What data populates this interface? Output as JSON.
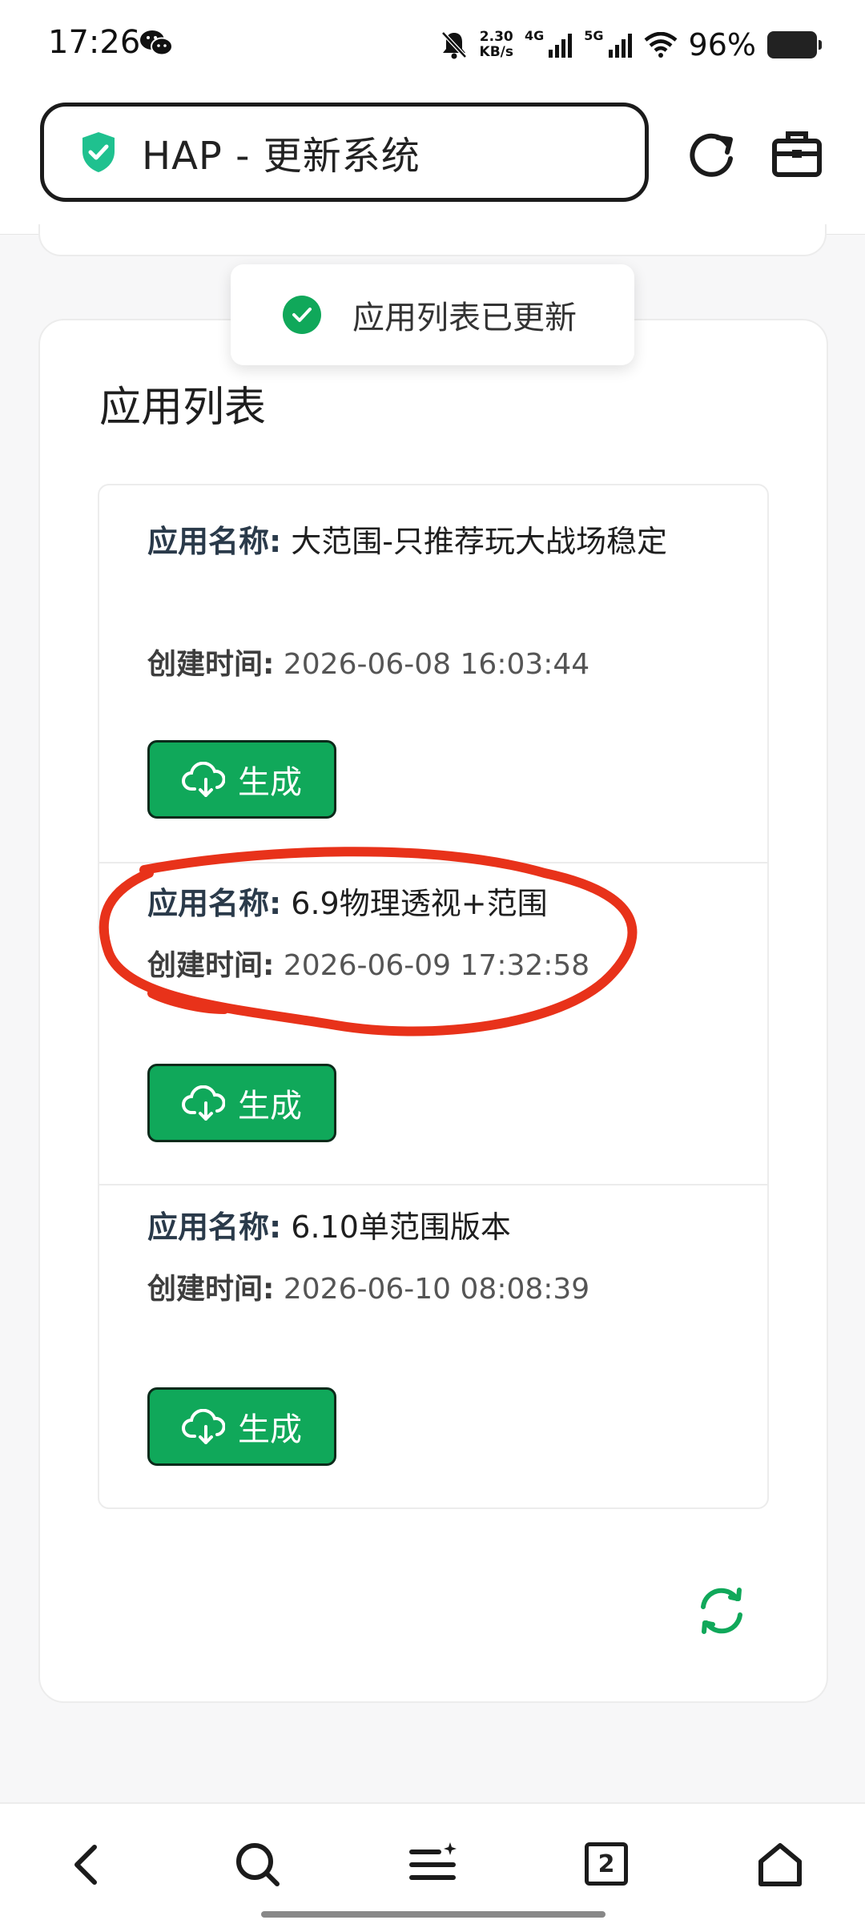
{
  "status_bar": {
    "time": "17:26",
    "net_speed_value": "2.30",
    "net_speed_unit": "KB/s",
    "network_1": "4G",
    "network_2": "5G",
    "battery": "96%"
  },
  "browser": {
    "title": "HAP - 更新系统"
  },
  "toast": {
    "message": "应用列表已更新"
  },
  "section": {
    "title": "应用列表"
  },
  "apps": [
    {
      "name_label": "应用名称:",
      "name": "大范围-只推荐玩大战场稳定",
      "time_label": "创建时间:",
      "time": "2026-06-08 16:03:44",
      "button": "生成"
    },
    {
      "name_label": "应用名称:",
      "name": "6.9物理透视+范围",
      "time_label": "创建时间:",
      "time": "2026-06-09 17:32:58",
      "button": "生成"
    },
    {
      "name_label": "应用名称:",
      "name": "6.10单范围版本",
      "time_label": "创建时间:",
      "time": "2026-06-10 08:08:39",
      "button": "生成"
    }
  ],
  "bottom_nav": {
    "tab_count": "2"
  },
  "colors": {
    "accent_green": "#10a85a",
    "annotation_red": "#e8321a"
  }
}
